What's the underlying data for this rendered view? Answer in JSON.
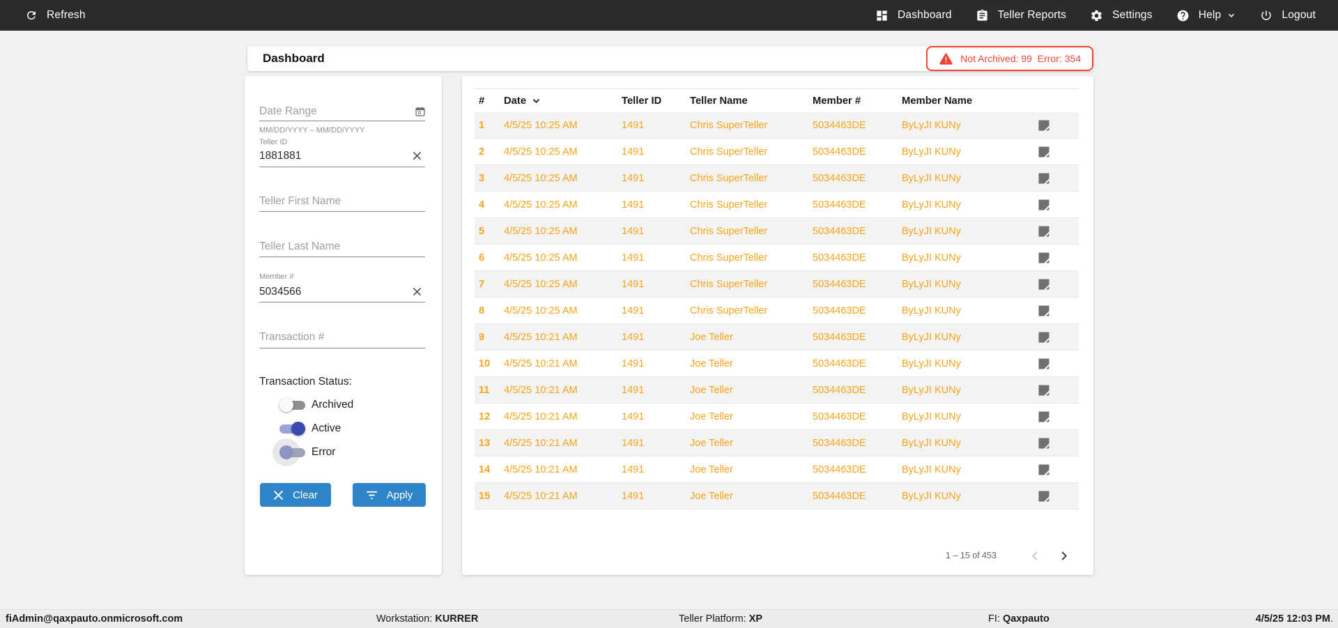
{
  "navbar": {
    "refresh_label": "Refresh",
    "dashboard_label": "Dashboard",
    "teller_reports_label": "Teller Reports",
    "settings_label": "Settings",
    "help_label": "Help",
    "logout_label": "Logout"
  },
  "header": {
    "title": "Dashboard",
    "alert": {
      "not_archived_label": "Not Archived:",
      "not_archived_value": "99",
      "error_label": "Error:",
      "error_value": "354"
    }
  },
  "filters": {
    "date_range": {
      "placeholder": "Date Range",
      "hint": "MM/DD/YYYY – MM/DD/YYYY"
    },
    "teller_id": {
      "label": "Teller ID",
      "value": "1881881"
    },
    "teller_first_name": {
      "placeholder": "Teller First Name"
    },
    "teller_last_name": {
      "placeholder": "Teller Last Name"
    },
    "member_number": {
      "label": "Member #",
      "value": "5034566"
    },
    "transaction_number": {
      "placeholder": "Transaction #"
    },
    "status_label": "Transaction Status:",
    "toggles": [
      {
        "label": "Archived",
        "state": "off"
      },
      {
        "label": "Active",
        "state": "on"
      },
      {
        "label": "Error",
        "state": "off-focused"
      }
    ],
    "clear_label": "Clear",
    "apply_label": "Apply"
  },
  "table": {
    "columns": [
      "#",
      "Date",
      "Teller ID",
      "Teller Name",
      "Member #",
      "Member Name"
    ],
    "sorted_column": "Date",
    "rows": [
      {
        "num": "1",
        "date": "4/5/25 10:25 AM",
        "teller_id": "1491",
        "teller_name": "Chris SuperTeller",
        "member_number": "5034463DE",
        "member_name": "ByLyJI KUNy"
      },
      {
        "num": "2",
        "date": "4/5/25 10:25 AM",
        "teller_id": "1491",
        "teller_name": "Chris SuperTeller",
        "member_number": "5034463DE",
        "member_name": "ByLyJI KUNy"
      },
      {
        "num": "3",
        "date": "4/5/25 10:25 AM",
        "teller_id": "1491",
        "teller_name": "Chris SuperTeller",
        "member_number": "5034463DE",
        "member_name": "ByLyJI KUNy"
      },
      {
        "num": "4",
        "date": "4/5/25 10:25 AM",
        "teller_id": "1491",
        "teller_name": "Chris SuperTeller",
        "member_number": "5034463DE",
        "member_name": "ByLyJI KUNy"
      },
      {
        "num": "5",
        "date": "4/5/25 10:25 AM",
        "teller_id": "1491",
        "teller_name": "Chris SuperTeller",
        "member_number": "5034463DE",
        "member_name": "ByLyJI KUNy"
      },
      {
        "num": "6",
        "date": "4/5/25 10:25 AM",
        "teller_id": "1491",
        "teller_name": "Chris SuperTeller",
        "member_number": "5034463DE",
        "member_name": "ByLyJI KUNy"
      },
      {
        "num": "7",
        "date": "4/5/25 10:25 AM",
        "teller_id": "1491",
        "teller_name": "Chris SuperTeller",
        "member_number": "5034463DE",
        "member_name": "ByLyJI KUNy"
      },
      {
        "num": "8",
        "date": "4/5/25 10:25 AM",
        "teller_id": "1491",
        "teller_name": "Chris SuperTeller",
        "member_number": "5034463DE",
        "member_name": "ByLyJI KUNy"
      },
      {
        "num": "9",
        "date": "4/5/25 10:21 AM",
        "teller_id": "1491",
        "teller_name": "Joe Teller",
        "member_number": "5034463DE",
        "member_name": "ByLyJI KUNy"
      },
      {
        "num": "10",
        "date": "4/5/25 10:21 AM",
        "teller_id": "1491",
        "teller_name": "Joe Teller",
        "member_number": "5034463DE",
        "member_name": "ByLyJI KUNy"
      },
      {
        "num": "11",
        "date": "4/5/25 10:21 AM",
        "teller_id": "1491",
        "teller_name": "Joe Teller",
        "member_number": "5034463DE",
        "member_name": "ByLyJI KUNy"
      },
      {
        "num": "12",
        "date": "4/5/25 10:21 AM",
        "teller_id": "1491",
        "teller_name": "Joe Teller",
        "member_number": "5034463DE",
        "member_name": "ByLyJI KUNy"
      },
      {
        "num": "13",
        "date": "4/5/25 10:21 AM",
        "teller_id": "1491",
        "teller_name": "Joe Teller",
        "member_number": "5034463DE",
        "member_name": "ByLyJI KUNy"
      },
      {
        "num": "14",
        "date": "4/5/25 10:21 AM",
        "teller_id": "1491",
        "teller_name": "Joe Teller",
        "member_number": "5034463DE",
        "member_name": "ByLyJI KUNy"
      },
      {
        "num": "15",
        "date": "4/5/25 10:21 AM",
        "teller_id": "1491",
        "teller_name": "Joe Teller",
        "member_number": "5034463DE",
        "member_name": "ByLyJI KUNy"
      }
    ],
    "pagination": {
      "range_text": "1 – 15 of 453"
    }
  },
  "footer": {
    "user": "fiAdmin@qaxpauto.onmicrosoft.com",
    "workstation_label": "Workstation: ",
    "workstation_value": "KURRER",
    "platform_label": "Teller Platform: ",
    "platform_value": "XP",
    "fi_label": "FI: ",
    "fi_value": "Qaxpauto",
    "datetime": "4/5/25 12:03 PM",
    "datetime_suffix": "."
  },
  "colors": {
    "accent_orange": "#f8a41d",
    "alert_red": "#f44336",
    "button_blue": "#2e86c8",
    "toggle_on_indigo": "#3c4ab0",
    "navbar_dark": "#2b2b2b"
  }
}
